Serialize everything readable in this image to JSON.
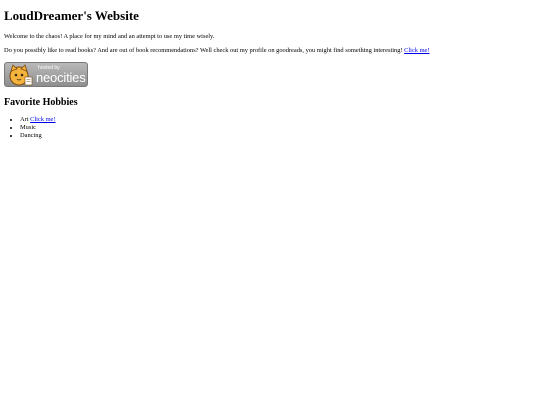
{
  "header": {
    "title": "LoudDreamer's Website"
  },
  "intro": {
    "text": "Welcome to the chaos! A place for my mind and an attempt to use my time wisely."
  },
  "books": {
    "text": "Do you possibly like to read books? And are out of book recommendations? Well check out my profile on goodreads, you might find something interesting!",
    "link_label": "Click me!"
  },
  "badge": {
    "small_text": "hosted by",
    "big_text": "neocities",
    "icon": "neocities-cat-icon"
  },
  "hobbies": {
    "heading": "Favorite Hobbies",
    "items": [
      {
        "label": "Art",
        "link_label": "Click me!"
      },
      {
        "label": "Music"
      },
      {
        "label": "Dancing"
      }
    ]
  },
  "colors": {
    "link": "#0000ee",
    "badge_bg": "#a0a0a0",
    "text": "#000000"
  }
}
